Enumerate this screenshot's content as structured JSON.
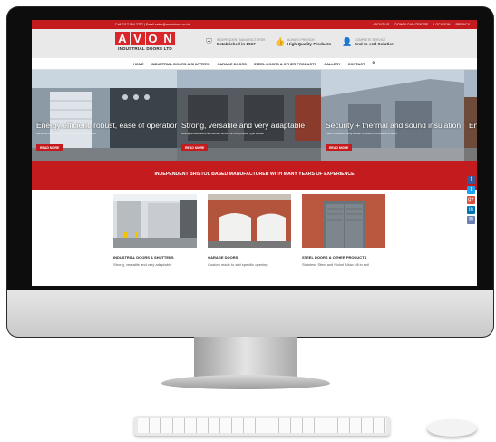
{
  "topbar": {
    "contact": "Call 0117 954 2757 | Email sales@avondoors.co.uk",
    "links": [
      "ABOUT US",
      "DOWNLOAD CENTRE",
      "LOCATION",
      "PRIVACY"
    ]
  },
  "logo": {
    "letters": [
      "A",
      "V",
      "O",
      "N"
    ],
    "subtitle": "INDUSTRIAL DOORS LTD"
  },
  "usps": [
    {
      "icon": "shield-icon",
      "label": "INDEPENDENT MANUFACTURER",
      "value": "Established in 1967"
    },
    {
      "icon": "thumbs-up-icon",
      "label": "ALWAYS PROVIDE",
      "value": "High Quality Products"
    },
    {
      "icon": "user-icon",
      "label": "COMPLETE SERVICE",
      "value": "End-to-end Solution"
    }
  ],
  "nav": [
    "HOME",
    "INDUSTRIAL DOORS & SHUTTERS",
    "GARAGE DOORS",
    "STEEL DOORS & OTHER PRODUCTS",
    "GALLERY",
    "CONTACT"
  ],
  "slides": [
    {
      "caption": "Energy efficient, robust, ease of operation",
      "sub": "Sectional door ideal for all types of industrial units",
      "button": "READ MORE"
    },
    {
      "caption": "Strong, versatile and very adaptable",
      "sub": "Rolling shutter doors are without doubt the most popular type of door",
      "button": "READ MORE"
    },
    {
      "caption": "Security + thermal and sound insulation",
      "sub": "Foam insulated rolling shutter is robust and durable product",
      "button": "READ MORE"
    },
    {
      "caption": "En",
      "sub": "",
      "button": ""
    }
  ],
  "banner": "INDEPENDENT BRISTOL BASED MANUFACTURER WITH MANY YEARS OF EXPERIENCE",
  "cards": [
    {
      "title": "INDUSTRIAL DOORS & SHUTTERS",
      "desc": "Strong, versatile and very adaptable"
    },
    {
      "title": "GARAGE DOORS",
      "desc": "Custom made to suit specific opening"
    },
    {
      "title": "STEEL DOORS & OTHER PRODUCTS",
      "desc": "Stainless Steel and Nickel Allow sill in soil"
    }
  ],
  "social": [
    {
      "icon": "facebook-icon",
      "glyph": "f",
      "color": "#3b5998"
    },
    {
      "icon": "twitter-icon",
      "glyph": "t",
      "color": "#1da1f2"
    },
    {
      "icon": "google-plus-icon",
      "glyph": "g+",
      "color": "#dd4b39"
    },
    {
      "icon": "linkedin-icon",
      "glyph": "in",
      "color": "#0077b5"
    },
    {
      "icon": "email-icon",
      "glyph": "✉",
      "color": "#6b7fb3"
    }
  ],
  "colors": {
    "brand_red": "#c41b1e",
    "logo_red": "#d8262a"
  }
}
